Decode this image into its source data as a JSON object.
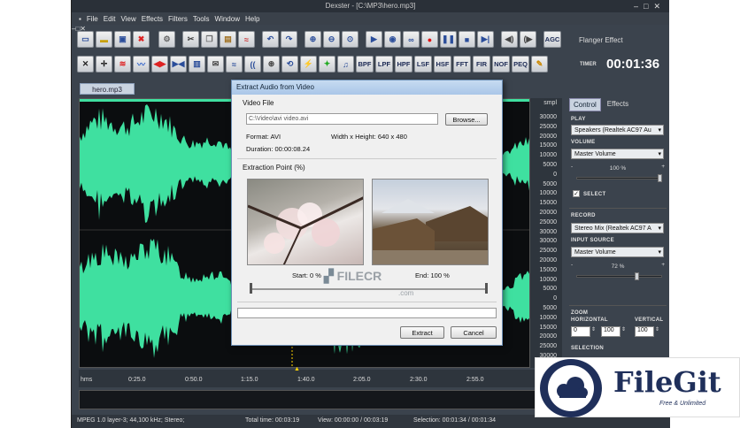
{
  "window": {
    "title": "Dexster - [C:\\MP3\\hero.mp3]"
  },
  "menu": [
    "File",
    "Edit",
    "View",
    "Effects",
    "Filters",
    "Tools",
    "Window",
    "Help"
  ],
  "toolbar1": {
    "effect_label": "Flanger Effect",
    "agc": "AGC"
  },
  "toolbar2": {
    "filters": [
      "BPF",
      "LPF",
      "HPF",
      "LSF",
      "HSF",
      "FFT",
      "FIR",
      "NOF",
      "PEQ"
    ],
    "timer_label": "TIMER",
    "timer_value": "00:01:36"
  },
  "tab": {
    "label": "hero.mp3"
  },
  "ruler": {
    "unit": "smpl",
    "ticks": [
      "30000",
      "25000",
      "20000",
      "15000",
      "10000",
      "5000",
      "0",
      "5000",
      "10000",
      "15000",
      "20000",
      "25000",
      "30000",
      "30000",
      "25000",
      "20000",
      "15000",
      "10000",
      "5000",
      "0",
      "5000",
      "10000",
      "15000",
      "20000",
      "25000",
      "30000"
    ]
  },
  "timeline": [
    "hms",
    "0:25.0",
    "0:50.0",
    "1:15.0",
    "1:40.0",
    "2:05.0",
    "2:30.0",
    "2:55.0"
  ],
  "side": {
    "tabs": [
      "Control",
      "Effects"
    ],
    "play_label": "PLAY",
    "play_device": "Speakers (Realtek AC97 Au",
    "volume_label": "VOLUME",
    "volume_select": "Master Volume",
    "volume_min": "-",
    "volume_max": "+",
    "volume_pct": "100 %",
    "select_label": "SELECT",
    "record_label": "RECORD",
    "record_device": "Stereo Mix (Realtek AC97 A",
    "input_label": "INPUT SOURCE",
    "input_select": "Master Volume",
    "input_pct": "72 %",
    "zoom_label": "ZOOM",
    "horizontal_label": "HORIZONTAL",
    "vertical_label": "VERTICAL",
    "zoom_h1": "0",
    "zoom_h2": "100",
    "zoom_v": "100",
    "selection_label": "SELECTION"
  },
  "volume_level": 1.0,
  "input_level": 0.72,
  "status": {
    "format": "MPEG 1.0 layer-3; 44,100 kHz; Stereo;",
    "total": "Total time: 00:03:19",
    "view": "View: 00:00:00 / 00:03:19",
    "selection": "Selection: 00:01:34 / 00:01:34"
  },
  "dialog": {
    "title": "Extract Audio from Video",
    "video_file_label": "Video File",
    "path": "C:\\Video\\avi video.avi",
    "browse": "Browse...",
    "format": "Format: AVI",
    "size": "Width x Height: 640 x 480",
    "duration": "Duration: 00:00:08.24",
    "extraction_label": "Extraction Point (%)",
    "start": "Start: 0 %",
    "end": "End: 100 %",
    "extract": "Extract",
    "cancel": "Cancel"
  },
  "watermarks": {
    "filecr": "FILECR",
    "filecr_sub": ".com",
    "filegit": "FileGit",
    "filegit_sub": "Free & Unlimited"
  },
  "colors": {
    "wave": "#3fe0a0",
    "bg": "#3b434d",
    "accent": "#2a4d9a"
  }
}
